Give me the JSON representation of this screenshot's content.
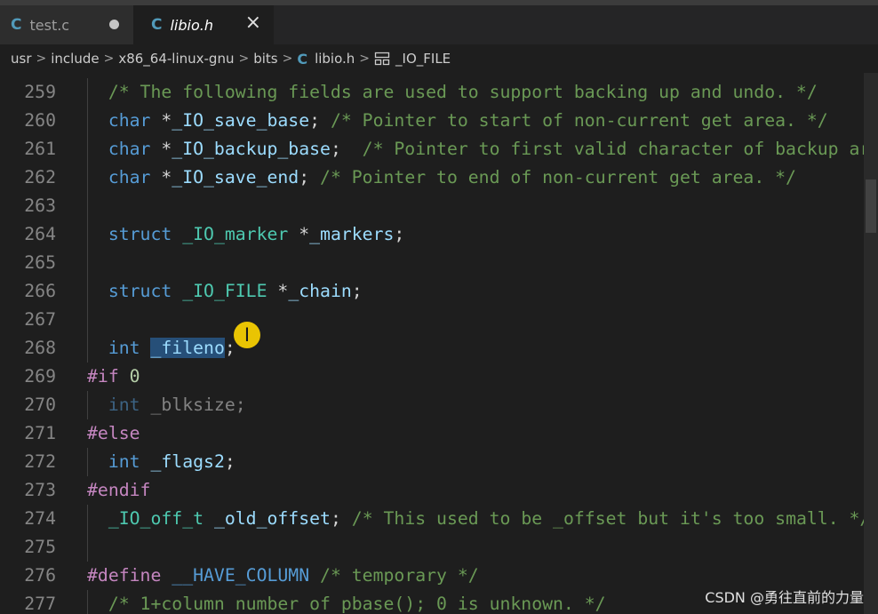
{
  "tabs": [
    {
      "icon": "C",
      "label": "test.c"
    },
    {
      "icon": "C",
      "label": "libio.h"
    }
  ],
  "breadcrumb": {
    "items": [
      "usr",
      "include",
      "x86_64-linux-gnu",
      "bits",
      "libio.h",
      "_IO_FILE"
    ],
    "file_icon": "C"
  },
  "editor": {
    "lines": [
      {
        "no": "259",
        "tokens": [
          [
            "cm",
            "/* The following fields are used to support backing up and undo. */"
          ]
        ]
      },
      {
        "no": "260",
        "tokens": [
          [
            "kw",
            "char"
          ],
          [
            "pn",
            " *"
          ],
          [
            "id",
            "_IO_save_base"
          ],
          [
            "pn",
            "; "
          ],
          [
            "cm",
            "/* Pointer to start of non-current get area. */"
          ]
        ]
      },
      {
        "no": "261",
        "tokens": [
          [
            "kw",
            "char"
          ],
          [
            "pn",
            " *"
          ],
          [
            "id",
            "_IO_backup_base"
          ],
          [
            "pn",
            ";  "
          ],
          [
            "cm",
            "/* Pointer to first valid character of backup area */"
          ]
        ]
      },
      {
        "no": "262",
        "tokens": [
          [
            "kw",
            "char"
          ],
          [
            "pn",
            " *"
          ],
          [
            "id",
            "_IO_save_end"
          ],
          [
            "pn",
            "; "
          ],
          [
            "cm",
            "/* Pointer to end of non-current get area. */"
          ]
        ]
      },
      {
        "no": "263",
        "tokens": []
      },
      {
        "no": "264",
        "tokens": [
          [
            "kw",
            "struct"
          ],
          [
            "pn",
            " "
          ],
          [
            "ty",
            "_IO_marker"
          ],
          [
            "pn",
            " *"
          ],
          [
            "id",
            "_markers"
          ],
          [
            "pn",
            ";"
          ]
        ]
      },
      {
        "no": "265",
        "tokens": []
      },
      {
        "no": "266",
        "tokens": [
          [
            "kw",
            "struct"
          ],
          [
            "pn",
            " "
          ],
          [
            "ty",
            "_IO_FILE"
          ],
          [
            "pn",
            " *"
          ],
          [
            "id",
            "_chain"
          ],
          [
            "pn",
            ";"
          ]
        ]
      },
      {
        "no": "267",
        "tokens": []
      },
      {
        "no": "268",
        "tokens": [
          [
            "kw",
            "int"
          ],
          [
            "pn",
            " "
          ],
          [
            "sel",
            "_fileno"
          ],
          [
            "pn",
            ";"
          ]
        ]
      },
      {
        "no": "269",
        "indent": 0,
        "tokens": [
          [
            "pp",
            "#if"
          ],
          [
            "pn",
            " "
          ],
          [
            "nm",
            "0"
          ]
        ]
      },
      {
        "no": "270",
        "dim": true,
        "tokens": [
          [
            "kw",
            "int"
          ],
          [
            "pn",
            " _blksize;"
          ]
        ]
      },
      {
        "no": "271",
        "indent": 0,
        "tokens": [
          [
            "pp",
            "#else"
          ]
        ]
      },
      {
        "no": "272",
        "tokens": [
          [
            "kw",
            "int"
          ],
          [
            "pn",
            " "
          ],
          [
            "id",
            "_flags2"
          ],
          [
            "pn",
            ";"
          ]
        ]
      },
      {
        "no": "273",
        "indent": 0,
        "tokens": [
          [
            "pp",
            "#endif"
          ]
        ]
      },
      {
        "no": "274",
        "tokens": [
          [
            "ty",
            "_IO_off_t"
          ],
          [
            "pn",
            " "
          ],
          [
            "id",
            "_old_offset"
          ],
          [
            "pn",
            "; "
          ],
          [
            "cm",
            "/* This used to be _offset but it's too small. */"
          ]
        ]
      },
      {
        "no": "275",
        "tokens": []
      },
      {
        "no": "276",
        "indent": 0,
        "tokens": [
          [
            "pp",
            "#define"
          ],
          [
            "pn",
            " "
          ],
          [
            "mc",
            "__HAVE_COLUMN"
          ],
          [
            "pn",
            " "
          ],
          [
            "cm",
            "/* temporary */"
          ]
        ]
      },
      {
        "no": "277",
        "tokens": [
          [
            "cm",
            "/* 1+column number of pbase(); 0 is unknown. */"
          ]
        ]
      }
    ]
  },
  "watermark": "CSDN @勇往直前的力量"
}
